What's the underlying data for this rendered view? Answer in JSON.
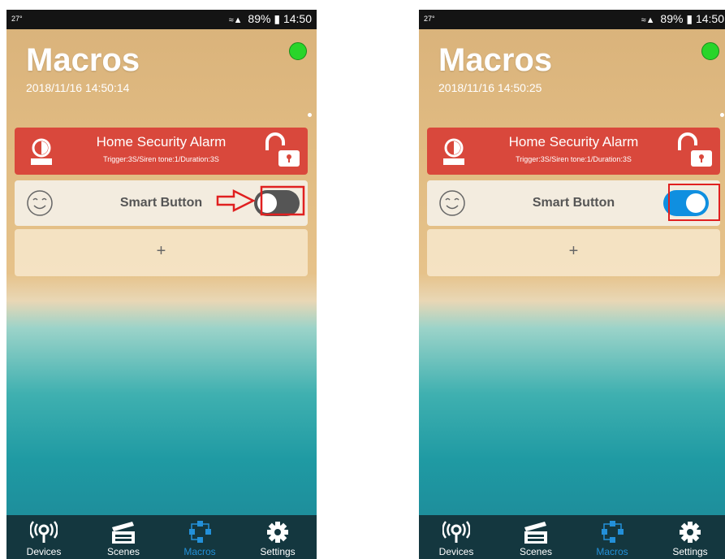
{
  "left": {
    "status": {
      "temperature": "27°",
      "battery": "89%",
      "time": "14:50"
    },
    "title": "Macros",
    "datetime": "2018/11/16 14:50:14",
    "alarm": {
      "name": "Home Security Alarm",
      "detail": "Trigger:3S/Siren tone:1/Duration:3S"
    },
    "smart_button": {
      "label": "Smart Button",
      "toggle_state": "off"
    },
    "add_label": "+",
    "nav": [
      {
        "label": "Devices",
        "icon": "devices-icon"
      },
      {
        "label": "Scenes",
        "icon": "clapperboard-icon"
      },
      {
        "label": "Macros",
        "icon": "macros-icon",
        "active": true
      },
      {
        "label": "Settings",
        "icon": "gear-icon"
      }
    ]
  },
  "right": {
    "status": {
      "temperature": "27°",
      "battery": "89%",
      "time": "14:50"
    },
    "title": "Macros",
    "datetime": "2018/11/16 14:50:25",
    "alarm": {
      "name": "Home Security Alarm",
      "detail": "Trigger:3S/Siren tone:1/Duration:3S"
    },
    "smart_button": {
      "label": "Smart Button",
      "toggle_state": "on"
    },
    "add_label": "+",
    "nav": [
      {
        "label": "Devices",
        "icon": "devices-icon"
      },
      {
        "label": "Scenes",
        "icon": "clapperboard-icon"
      },
      {
        "label": "Macros",
        "icon": "macros-icon",
        "active": true
      },
      {
        "label": "Settings",
        "icon": "gear-icon"
      }
    ]
  },
  "colors": {
    "alarm_red": "#d9483c",
    "toggle_on": "#0f8fe0",
    "toggle_off": "#555555",
    "nav_bg": "#14373f",
    "nav_active": "#2390d9",
    "highlight": "#e02020",
    "online_dot": "#29d52a"
  }
}
